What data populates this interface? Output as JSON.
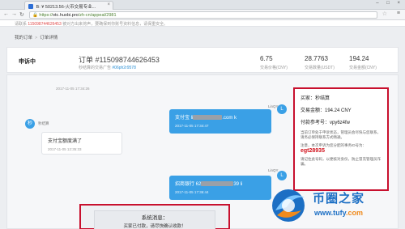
{
  "browser": {
    "tab_title": "B: ¥ 50213.56-火币交易专业...",
    "url_host": "otc.huobi.pro",
    "url_scheme": "https://",
    "url_path": "/zh-cn/appeal/2981",
    "window_controls": "– □ ×"
  },
  "notice": {
    "text_before": "请联系 ",
    "number": "115098744626453",
    "text_after": " 被对方出来将声，要确保到你账号资料信息，请保重安全。"
  },
  "breadcrumb": {
    "home": "我的订单",
    "separator": ">",
    "current": "订单详情"
  },
  "order": {
    "status": "申诉中",
    "title": "订单 #115098744626453",
    "sub_prefix": "秒结算的交易广告 ",
    "sub_id": "#06ph2r9578",
    "stats": [
      {
        "value": "6.75",
        "label": "交易价格(CNY)"
      },
      {
        "value": "28.7763",
        "label": "交易数量(USDT)"
      },
      {
        "value": "194.24",
        "label": "交易金额(CNY)"
      }
    ]
  },
  "chat": {
    "messages": [
      {
        "side": "right",
        "sender": "LinQY",
        "text_prefix": "支付宝 li",
        "text_suffix": ".com k",
        "time": "2017-11-05 17:34:47"
      },
      {
        "side": "left",
        "sender": "秒",
        "text": "支付宝额度满了",
        "time": "2017-11-05 12:35:33"
      },
      {
        "side": "right",
        "sender": "LinQY",
        "text_prefix": "招商银行 62",
        "text_suffix": "39 li",
        "time": "2017-11-05 17:36:44"
      }
    ],
    "top_time": "2017-11-05 17:34:26",
    "avatar_right": "L",
    "avatar_left": "秒",
    "left_name": "秒结算"
  },
  "buyer_box": {
    "buyer": "买家：秒结算",
    "amount": "交易金额：194.24 CNY",
    "ref": "付款参考号：vpy6z4fw",
    "note_1": "当前订单处于申诉状态，管理员会尽快与您联系，请务必保持联系方式畅通。",
    "note_2": "注意，本次申诉为您分配的事务ID号为：",
    "code": "egt28935",
    "note_3": "请记住此号码，以便核对身份，防止冒充管理员诈骗。"
  },
  "system_message": {
    "title": "系统消息：",
    "text": "买家已付款，请尽快确认收款！"
  },
  "watermark": {
    "brand": "币圈之家",
    "url_main": "www.tufy",
    "url_accent": ".com"
  },
  "colors": {
    "accent_blue": "#3aa0e6",
    "alert_red": "#c8102e",
    "brand_blue": "#1c6fc4",
    "brand_orange": "#ef8a1c"
  }
}
